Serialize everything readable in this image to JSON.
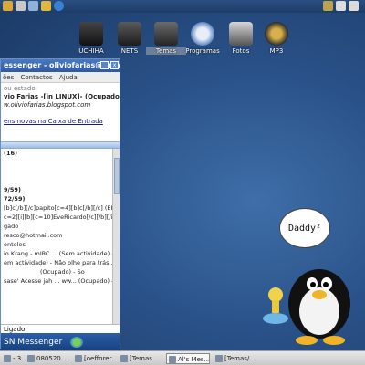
{
  "top_panel": {
    "icons": [
      "folder-icon",
      "home-icon",
      "trash-icon",
      "network-icon",
      "web-browser-icon"
    ],
    "tray_icons": [
      "window-icon",
      "window-icon",
      "window-icon"
    ]
  },
  "desktop": {
    "icons": [
      {
        "label": "UCHIHA",
        "icon": "drive-icon"
      },
      {
        "label": "NETS",
        "icon": "tux-folder-icon"
      },
      {
        "label": "Temas",
        "icon": "tux-folder-icon"
      },
      {
        "label": "Programas",
        "icon": "tux-bird-icon"
      },
      {
        "label": "Fotos",
        "icon": "photo-folder-icon"
      },
      {
        "label": "MP3",
        "icon": "music-folder-icon"
      }
    ],
    "bubble_text": "Daddy²"
  },
  "messenger": {
    "title": "essenger - oliviofarias@gma",
    "menu": [
      "ões",
      "Contactos",
      "Ajuda"
    ],
    "status_prompt": "ou estado:",
    "display_name": "vio Farias -[in LINUX]- (Ocupado)",
    "website": "w.oliviofarias.blogspot.com",
    "mail_notice": "ens novas na Caixa de Entrada",
    "contacts": [
      {
        "text": "(16)",
        "group": true
      },
      {
        "text": "9/59)",
        "group": true
      },
      {
        "text": "72/59)",
        "group": true
      },
      {
        "text": "[b]c[/b][/c]papito[c=4][b]c[/b][/c] (ER... - pi"
      },
      {
        "text": "c=2][i][b][c=10]EveRicardo[/c][/b][/i] ... - \"k"
      },
      {
        "text": "gado"
      },
      {
        "text": "resco@hotmail.com"
      },
      {
        "text": "onteles"
      },
      {
        "text": "io Krang - mIRC ... (Sem actividade) - Pe"
      },
      {
        "text": "em actividade) - Não olhe para trás... o q"
      },
      {
        "text": "(Ocupado) - So"
      },
      {
        "text": "sase' Acesse jah ... ww... (Ocupado) - Sc"
      }
    ],
    "status_combo": "Ligado",
    "logo_text": "SN Messenger"
  },
  "taskbar": {
    "items": [
      {
        "label": "- 3...",
        "active": false
      },
      {
        "label": "080520...",
        "active": false
      },
      {
        "label": "[oeffnrer...",
        "active": false
      },
      {
        "label": "[Temas",
        "active": false
      },
      {
        "label": "Al's Mes...",
        "active": true
      },
      {
        "label": "[Temas/...",
        "active": false
      }
    ]
  }
}
